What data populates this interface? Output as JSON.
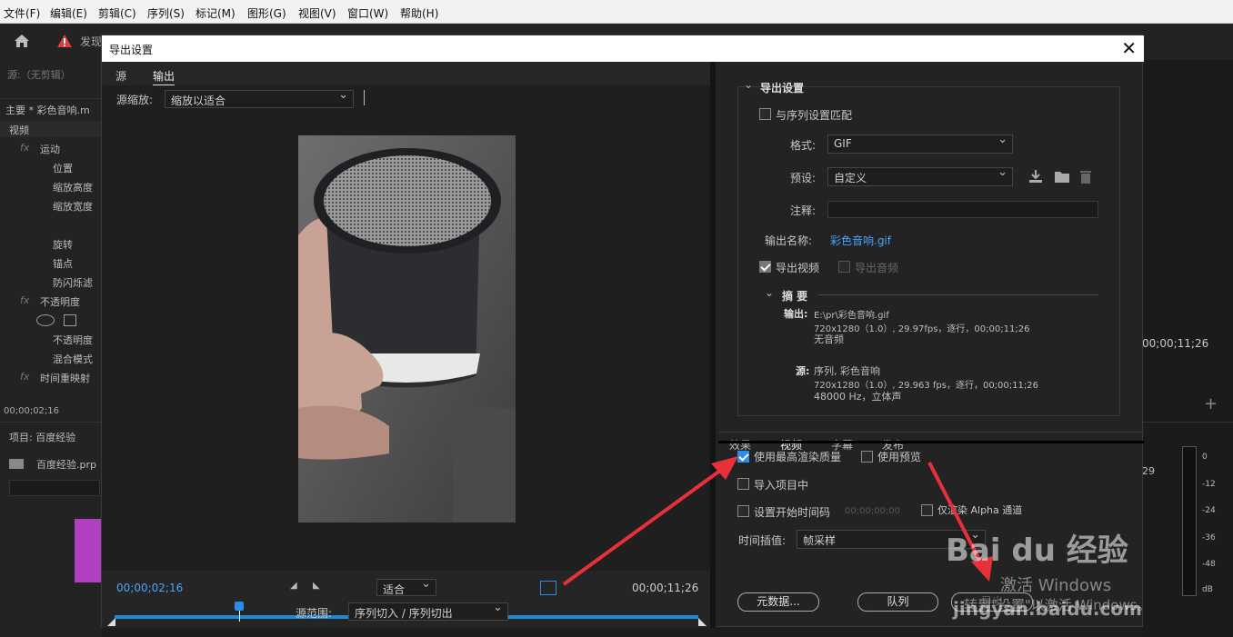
{
  "menu": [
    "文件(F)",
    "编辑(E)",
    "剪辑(C)",
    "序列(S)",
    "标记(M)",
    "图形(G)",
    "视图(V)",
    "窗口(W)",
    "帮助(H)"
  ],
  "app": {
    "warning_text": "发现"
  },
  "left_panel": {
    "source_label": "源:（无剪辑）",
    "main_clip": "主要 * 彩色音响.m",
    "video_label": "视频",
    "effects": [
      "运动",
      "位置",
      "缩放高度",
      "缩放宽度",
      "旋转",
      "锚点",
      "防闪烁滤",
      "不透明度",
      "不透明度",
      "混合模式",
      "时间重映射"
    ],
    "timecode": "00;00;02;16",
    "project_label": "项目: 百度经验",
    "project_file": "百度经验.prp"
  },
  "dialog": {
    "title": "导出设置",
    "close_label": "✕",
    "tabs": [
      "源",
      "输出"
    ],
    "source_scaling_label": "源缩放:",
    "source_scaling_value": "缩放以适合",
    "timecode_current": "00;00;02;16",
    "timecode_end": "00;00;11;26",
    "fit_value": "适合",
    "source_range_label": "源范围:",
    "source_range_value": "序列切入 / 序列切出",
    "export_settings": {
      "header": "导出设置",
      "match_sequence": "与序列设置匹配",
      "format_label": "格式:",
      "format_value": "GIF",
      "preset_label": "预设:",
      "preset_value": "自定义",
      "comments_label": "注释:",
      "output_name_label": "输出名称:",
      "output_name_value": "彩色音响.gif",
      "export_video": "导出视频",
      "export_audio": "导出音频",
      "summary_header": "摘 要",
      "output_label": "输出:",
      "output_lines": [
        "E:\\pr\\彩色音响.gif",
        "720x1280（1.0）, 29.97fps，逐行，00;00;11;26",
        "无音频"
      ],
      "source_label": "源:",
      "source_lines": [
        "序列, 彩色音响",
        "720x1280（1.0）, 29.963 fps，逐行，00;00;11;26",
        "48000 Hz，立体声"
      ]
    },
    "lower_tabs": [
      "效果",
      "视频",
      "字幕",
      "发布"
    ],
    "max_render_quality": "使用最高渲染质量",
    "use_previews": "使用预览",
    "import_into_project": "导入项目中",
    "set_start_timecode": "设置开始时间码",
    "start_timecode_value": "00;00;00;00",
    "render_alpha_only": "仅渲染 Alpha 通道",
    "time_interpolation_label": "时间插值:",
    "time_interpolation_value": "帧采样",
    "metadata_button": "元数据...",
    "queue_button": "队列",
    "export_button": "导出"
  },
  "right_panel": {
    "timecode": "00;00;11;26",
    "meter_ticks": [
      "0",
      "-12",
      "-24",
      "-36",
      "-48",
      "dB"
    ],
    "number_29": "29"
  },
  "watermark": {
    "activate_title": "激活 Windows",
    "activate_sub": "转到\"设置\"以激活 Windows。",
    "baidu_logo": "Bai du 经验",
    "site": "jingyan.baidu.com"
  },
  "colors": {
    "accent": "#2d8ceb",
    "arrow": "#e8303a",
    "link": "#4aa3ff"
  }
}
